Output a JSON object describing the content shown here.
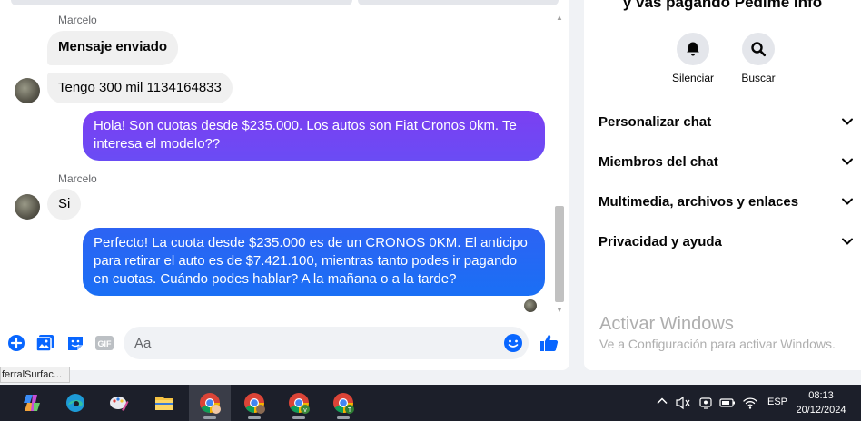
{
  "chat": {
    "messages": [
      {
        "sender": "Marcelo",
        "text": "Mensaje enviado"
      },
      {
        "text": "Tengo 300 mil  1134164833"
      },
      {
        "text": "Hola! Son cuotas desde $235.000. Los autos son Fiat Cronos 0km. Te interesa el modelo??"
      },
      {
        "sender": "Marcelo",
        "text": "Si"
      },
      {
        "text": "Perfecto! La cuota desde $235.000 es de un CRONOS 0KM. El anticipo para retirar el auto es de $7.421.100, mientras tanto podes ir pagando en cuotas. Cuándo podes hablar? A la mañana o a la tarde?"
      }
    ],
    "composer": {
      "placeholder": "Aa"
    },
    "colors": {
      "outgoing_gradient_top": "#7b3ff2",
      "outgoing_gradient_bottom": "#1a6ff5",
      "accent": "#0866ff"
    }
  },
  "info": {
    "title": "y vas pagando Pedime info",
    "actions": [
      {
        "label": "Silenciar",
        "icon": "bell-icon"
      },
      {
        "label": "Buscar",
        "icon": "search-icon"
      }
    ],
    "sections": [
      {
        "label": "Personalizar chat"
      },
      {
        "label": "Miembros del chat"
      },
      {
        "label": "Multimedia, archivos y enlaces"
      },
      {
        "label": "Privacidad y ayuda"
      }
    ]
  },
  "watermark": {
    "line1": "Activar Windows",
    "line2": "Ve a Configuración para activar Windows."
  },
  "tooltip": "ferralSurfac...",
  "taskbar": {
    "apps": [
      "copilot-icon",
      "edge-icon",
      "paint-icon",
      "file-explorer-icon",
      "chrome-icon",
      "chrome-profile-icon",
      "chrome-profile-v-icon",
      "chrome-profile-t-icon"
    ],
    "language": "ESP",
    "time": "08:13",
    "date": "20/12/2024"
  }
}
